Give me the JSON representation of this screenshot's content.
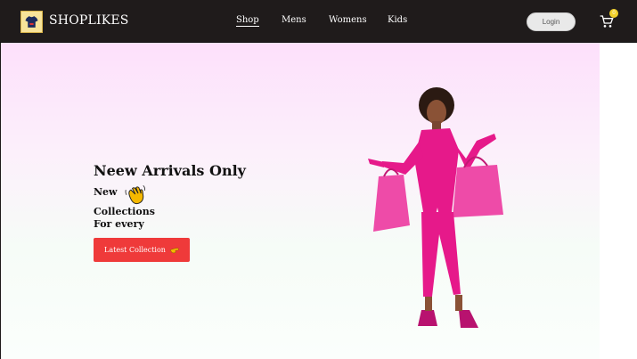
{
  "header": {
    "brand": "SHOPLIKES",
    "nav": [
      {
        "label": "Shop",
        "active": true
      },
      {
        "label": "Mens"
      },
      {
        "label": "Womens"
      },
      {
        "label": "Kids"
      }
    ],
    "login_label": "Login",
    "cart_count": "0"
  },
  "hero": {
    "title": "Neew Arrivals Only",
    "line1": "New",
    "line2": "Collections",
    "line3": "For every",
    "cta_label": "Latest Collection"
  },
  "icons": {
    "logo": "tshirt-icon",
    "wave": "waving-hand-icon",
    "cta_icon": "pointing-hand-icon",
    "cart": "cart-icon"
  },
  "colors": {
    "accent": "#ef3a3a",
    "navbar": "#1f1b1b",
    "badge": "#f2d12b",
    "model_outfit": "#e6198a"
  }
}
